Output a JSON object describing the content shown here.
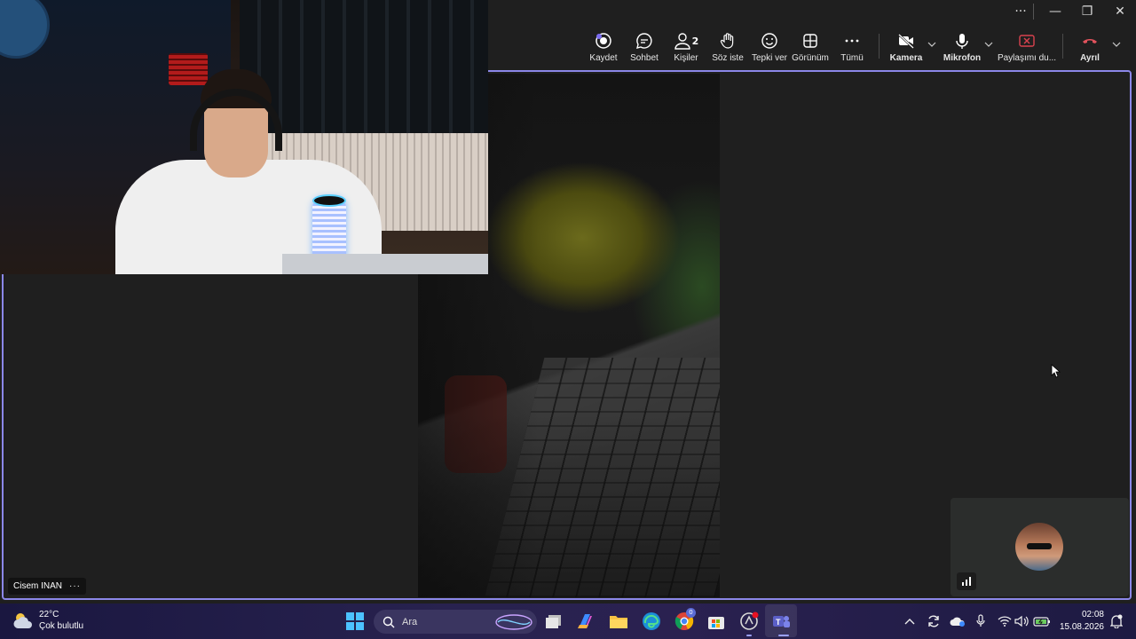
{
  "window": {
    "more": "···",
    "minimize": "—",
    "restore": "❐",
    "close": "✕"
  },
  "toolbar": {
    "record_label": "Kaydet",
    "chat_label": "Sohbet",
    "people_label": "Kişiler",
    "people_count": "2",
    "raise_hand_label": "Söz iste",
    "react_label": "Tepki ver",
    "view_label": "Görünüm",
    "more_label": "Tümü",
    "camera_label": "Kamera",
    "mic_label": "Mikrofon",
    "share_label": "Paylaşımı du...",
    "leave_label": "Ayrıl",
    "leave_color": "#e0525c",
    "share_color": "#d9424e"
  },
  "stage": {
    "accent_color": "#8b87e8",
    "participant_name": "Cisem INAN",
    "participant_more": "···"
  },
  "taskbar": {
    "weather_temp": "22°C",
    "weather_desc": "Çok bulutlu",
    "search_placeholder": "Ara",
    "time": "02:08",
    "date": "15.08.2026",
    "copilot_badge": "0"
  }
}
